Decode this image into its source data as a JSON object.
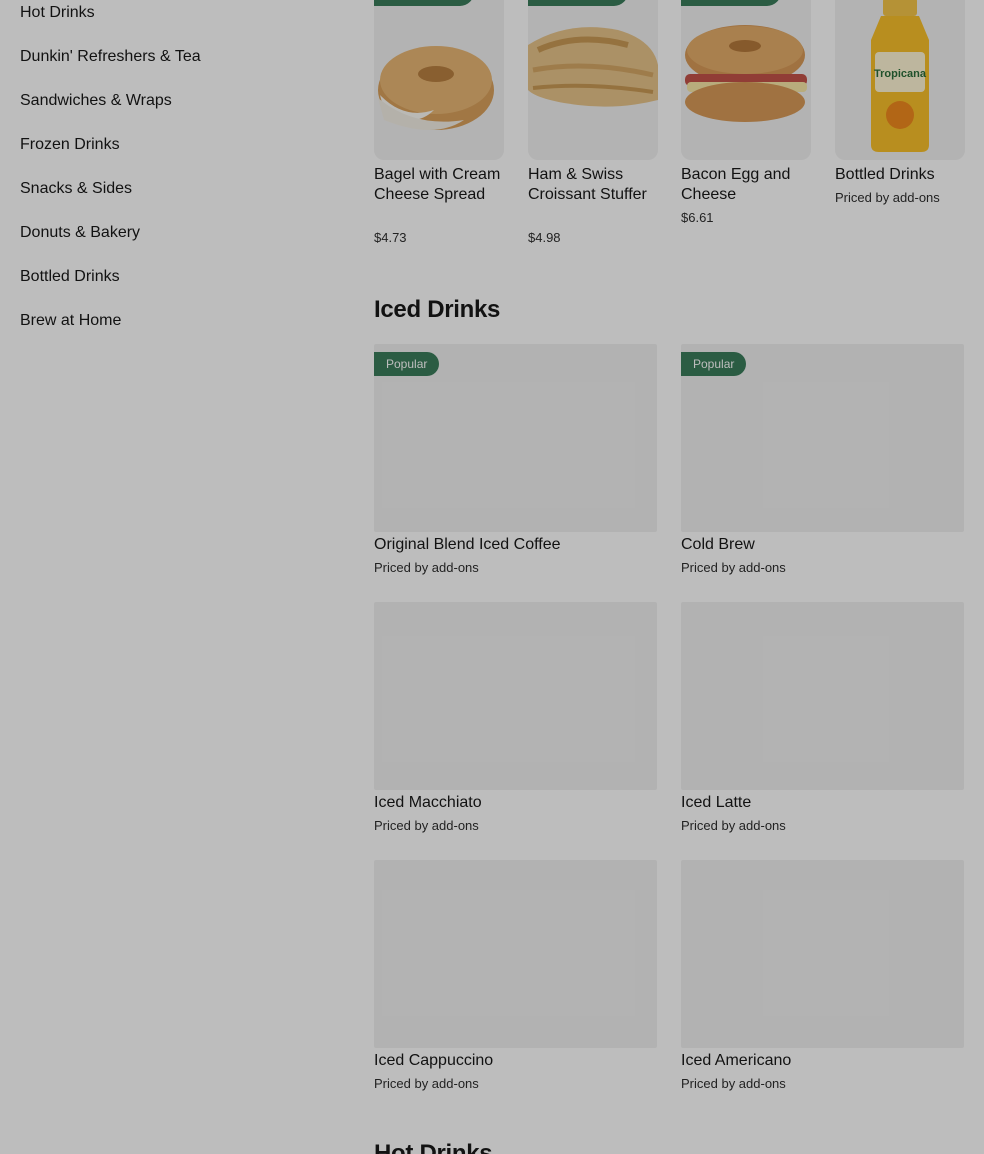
{
  "sidebar": {
    "items": [
      {
        "label": "Hot Drinks"
      },
      {
        "label": "Dunkin' Refreshers & Tea"
      },
      {
        "label": "Sandwiches & Wraps"
      },
      {
        "label": "Frozen Drinks"
      },
      {
        "label": "Snacks & Sides"
      },
      {
        "label": "Donuts & Bakery"
      },
      {
        "label": "Bottled Drinks"
      },
      {
        "label": "Brew at Home"
      }
    ]
  },
  "top_items": [
    {
      "title": "Bagel with Cream Cheese Spread",
      "price": "$4.73",
      "icon": "bagel-image"
    },
    {
      "title": "Ham & Swiss Croissant Stuffer",
      "price": "$4.98",
      "icon": "croissant-image"
    },
    {
      "title": "Bacon Egg and Cheese",
      "price": "$6.61",
      "icon": "sandwich-image"
    },
    {
      "title": "Bottled Drinks",
      "price": "Priced by add-ons",
      "icon": "juice-bottle-image"
    }
  ],
  "bottle_label": "Tropicana",
  "iced_section": {
    "heading": "Iced Drinks",
    "badge": "Popular",
    "items": [
      {
        "title": "Original Blend Iced Coffee",
        "price": "Priced by add-ons"
      },
      {
        "title": "Cold Brew",
        "price": "Priced by add-ons"
      },
      {
        "title": "Iced Macchiato",
        "price": "Priced by add-ons"
      },
      {
        "title": "Iced Latte",
        "price": "Priced by add-ons"
      },
      {
        "title": "Iced Cappuccino",
        "price": "Priced by add-ons"
      },
      {
        "title": "Iced Americano",
        "price": "Priced by add-ons"
      }
    ]
  },
  "next_section": {
    "heading": "Hot Drinks"
  },
  "colors": {
    "badge_green": "#3a7c5b",
    "overlay": "rgba(0,0,0,0.26)"
  }
}
